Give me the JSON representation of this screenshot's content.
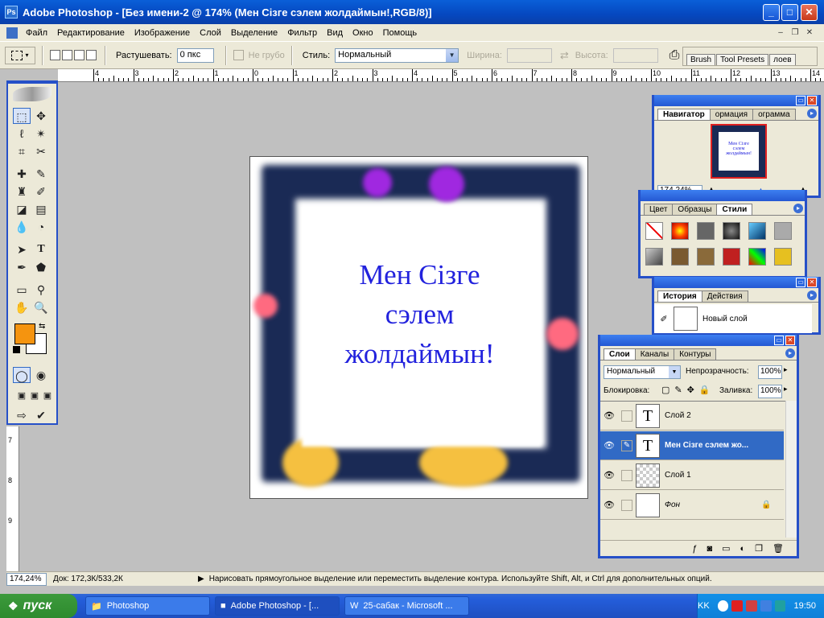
{
  "window": {
    "title": "Adobe Photoshop - [Без имени-2 @ 174% (Мен Сізге  сэлем  жолдаймын!,RGB/8)]"
  },
  "menu": [
    "Файл",
    "Редактирование",
    "Изображение",
    "Слой",
    "Выделение",
    "Фильтр",
    "Вид",
    "Окно",
    "Помощь"
  ],
  "options": {
    "feather_label": "Растушевать:",
    "feather_value": "0 пкс",
    "antialias_label": "Не грубо",
    "style_label": "Стиль:",
    "style_value": "Нормальный",
    "width_label": "Ширина:",
    "height_label": "Высота:",
    "well_tabs": [
      "Brush",
      "Tool Presets",
      "лоев"
    ]
  },
  "ruler_h": [
    "4",
    "3",
    "2",
    "1",
    "0",
    "1",
    "2",
    "3",
    "4",
    "5",
    "6",
    "7",
    "8",
    "9",
    "10",
    "11",
    "12",
    "13",
    "14"
  ],
  "ruler_v": [
    "7",
    "8",
    "9"
  ],
  "canvas": {
    "lines": [
      "Мен Сізге",
      "сэлем",
      "жолдаймын!"
    ]
  },
  "colors": {
    "foreground": "#f5940f",
    "background": "#ffffff",
    "text": "#2222dd",
    "frame": "#1a2a55"
  },
  "navigator": {
    "tabs": [
      "Навигатор",
      "ормация",
      "ограмма"
    ],
    "zoom": "174,24%"
  },
  "styles_panel": {
    "tabs": [
      "Цвет",
      "Образцы",
      "Стили"
    ]
  },
  "history_panel": {
    "tabs": [
      "История",
      "Действия"
    ],
    "item": "Новый слой"
  },
  "layers_panel": {
    "tabs": [
      "Слои",
      "Каналы",
      "Контуры"
    ],
    "blend": "Нормальный",
    "opacity_label": "Непрозрачность:",
    "opacity_value": "100%",
    "lock_label": "Блокировка:",
    "fill_label": "Заливка:",
    "fill_value": "100%",
    "layers": [
      {
        "name": "Слой 2",
        "thumb": "T"
      },
      {
        "name": "Мен Сізге  сэлем  жо...",
        "thumb": "T"
      },
      {
        "name": "Слой 1",
        "thumb": ""
      },
      {
        "name": "Фон",
        "thumb": ""
      }
    ]
  },
  "status": {
    "zoom": "174,24%",
    "doc": "Док: 172,3К/533,2К",
    "hint": "Нарисовать прямоугольное выделение или переместить выделение контура. Используйте Shift, Alt, и Ctrl для дополнительных опций."
  },
  "taskbar": {
    "start": "пуск",
    "tasks": [
      "Photoshop",
      "Adobe Photoshop - [...",
      "25-сабак - Microsoft ..."
    ],
    "lang": "KK",
    "clock": "19:50"
  }
}
